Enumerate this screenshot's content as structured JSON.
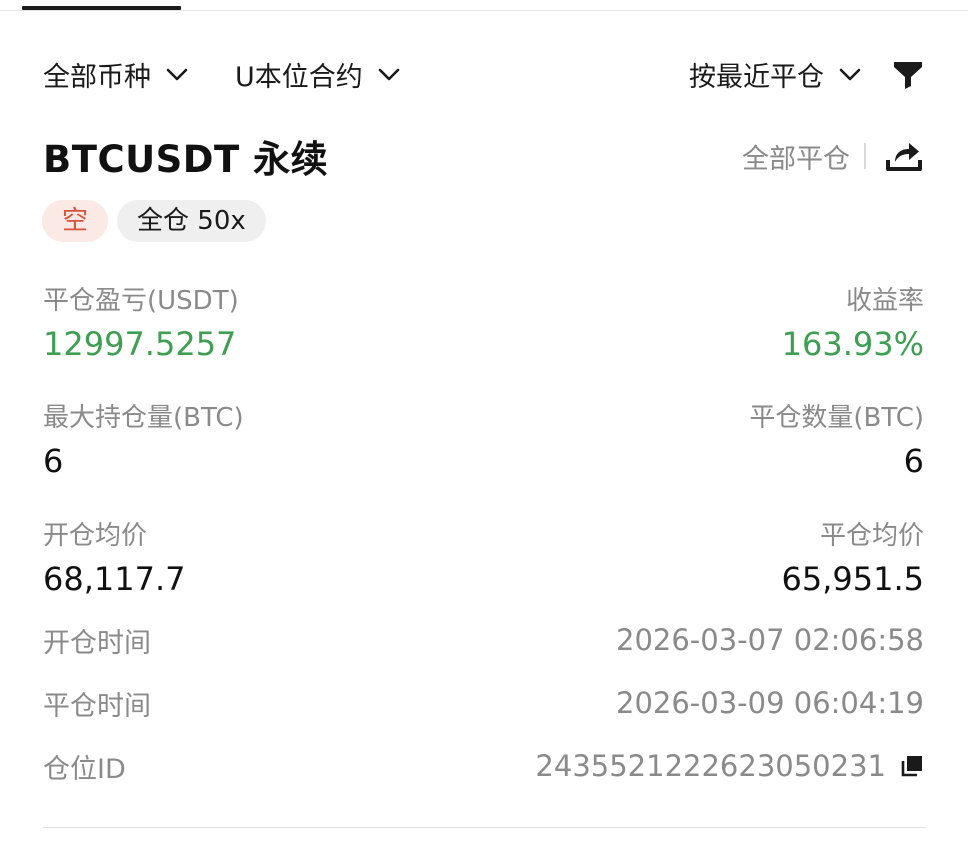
{
  "filters": {
    "coin": "全部币种",
    "contract_type": "U本位合约",
    "sort": "按最近平仓"
  },
  "position": {
    "symbol": "BTCUSDT 永续",
    "close_all_label": "全部平仓",
    "side_badge": "空",
    "margin_badge": "全仓 50x",
    "pnl_label": "平仓盈亏(USDT)",
    "pnl_value": "12997.5257",
    "roi_label": "收益率",
    "roi_value": "163.93%",
    "max_position_label": "最大持仓量(BTC)",
    "max_position_value": "6",
    "closed_qty_label": "平仓数量(BTC)",
    "closed_qty_value": "6",
    "entry_price_label": "开仓均价",
    "entry_price_value": "68,117.7",
    "exit_price_label": "平仓均价",
    "exit_price_value": "65,951.5",
    "open_time_label": "开仓时间",
    "open_time_value": "2026-03-07 02:06:58",
    "close_time_label": "平仓时间",
    "close_time_value": "2026-03-09 06:04:19",
    "position_id_label": "仓位ID",
    "position_id_value": "243552122262305023​1"
  },
  "colors": {
    "profit": "#3e9e51",
    "short": "#d9533b",
    "muted": "#8a8a8a"
  },
  "icons": {
    "filter": "funnel-icon",
    "share": "share-icon",
    "copy": "copy-icon",
    "dropdown": "chevron-down-icon"
  }
}
